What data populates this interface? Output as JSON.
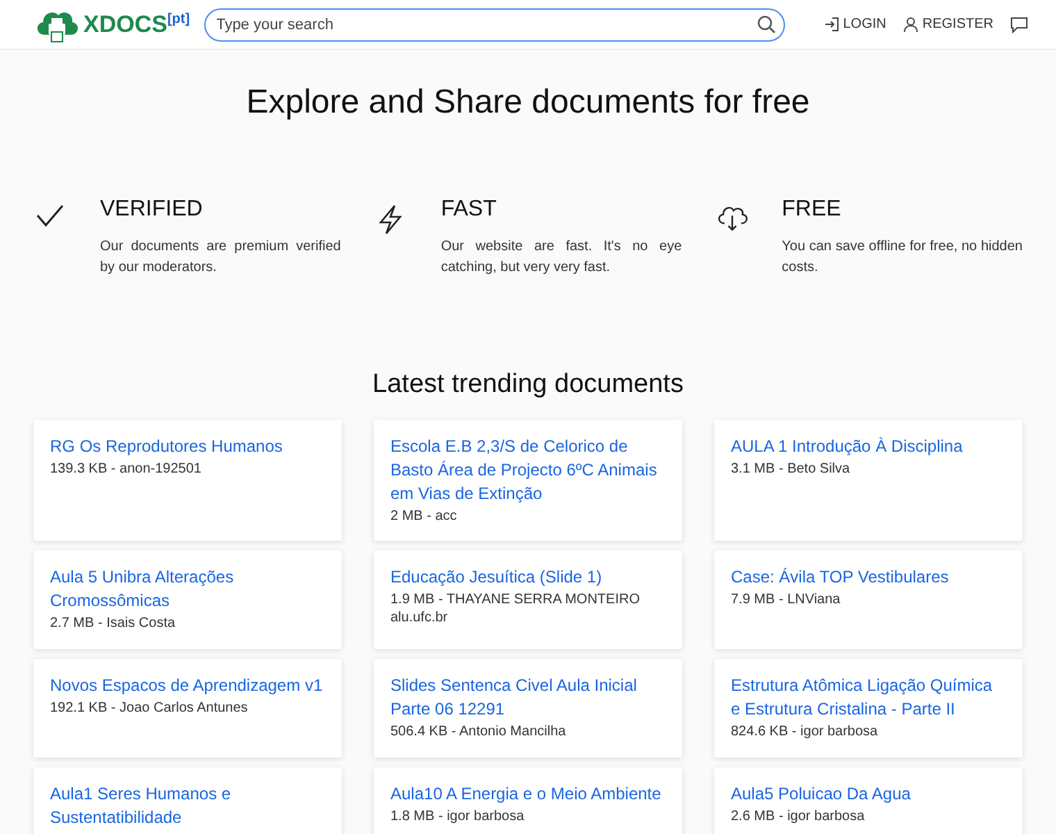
{
  "header": {
    "logo": "XDOCS$^{[pt]}$",
    "search": {
      "placeholder": "Type your search"
    },
    "nav": [
      {
        "label": "LOGIN",
        "kind": "login"
      },
      {
        "label": "REGISTER",
        "kind": "register"
      },
      {
        "kind": "feedback"
      }
    ]
  },
  "hero": {
    "title": "Explore and Share documents for free"
  },
  "features": [
    {
      "kind": "check",
      "title": "VERIFIED",
      "text": "Our documents are premium verified by our moderators."
    },
    {
      "kind": "bolt",
      "title": "FAST",
      "text": "Our website are fast. It's no eye catching, but very very fast."
    },
    {
      "kind": "cloud",
      "title": "FREE",
      "text": "You can save offline for free, no hidden costs."
    }
  ],
  "trending": {
    "title": "Latest trending documents",
    "documents": [
      {
        "title": "RG Os Reprodutores Humanos",
        "meta": "139.3 KB - anon-192501"
      },
      {
        "title": "Escola E.B 2,3/S de Celorico de Basto Área de Projecto 6ºC Animais em Vias de Extinção",
        "meta": "2 MB - acc"
      },
      {
        "title": "AULA 1 Introdução À Disciplina",
        "meta": "3.1 MB - Beto Silva"
      },
      {
        "title": "Aula 5 Unibra Alterações Cromossômicas",
        "meta": "2.7 MB - Isais Costa"
      },
      {
        "title": "Educação Jesuítica (Slide 1)",
        "meta": "1.9 MB - THAYANE SERRA MONTEIRO",
        "extra": "alu.ufc.br"
      },
      {
        "title": "Case: Ávila TOP Vestibulares",
        "meta": "7.9 MB - LNViana"
      },
      {
        "title": "Novos Espacos de Aprendizagem v1",
        "meta": "192.1 KB - Joao Carlos Antunes"
      },
      {
        "title": "Slides Sentenca Civel Aula Inicial Parte 06 12291",
        "meta": "506.4 KB - Antonio Mancilha"
      },
      {
        "title": "Estrutura Atômica Ligação Química e Estrutura Cristalina - Parte II",
        "meta": "824.6 KB - igor barbosa"
      },
      {
        "title": "Aula1 Seres Humanos e Sustentatibilidade"
      },
      {
        "title": "Aula10 A Energia e o Meio Ambiente",
        "meta": "1.8 MB - igor barbosa"
      },
      {
        "title": "Aula5 Poluicao Da Agua",
        "meta": "2.6 MB - igor barbosa"
      }
    ]
  }
}
